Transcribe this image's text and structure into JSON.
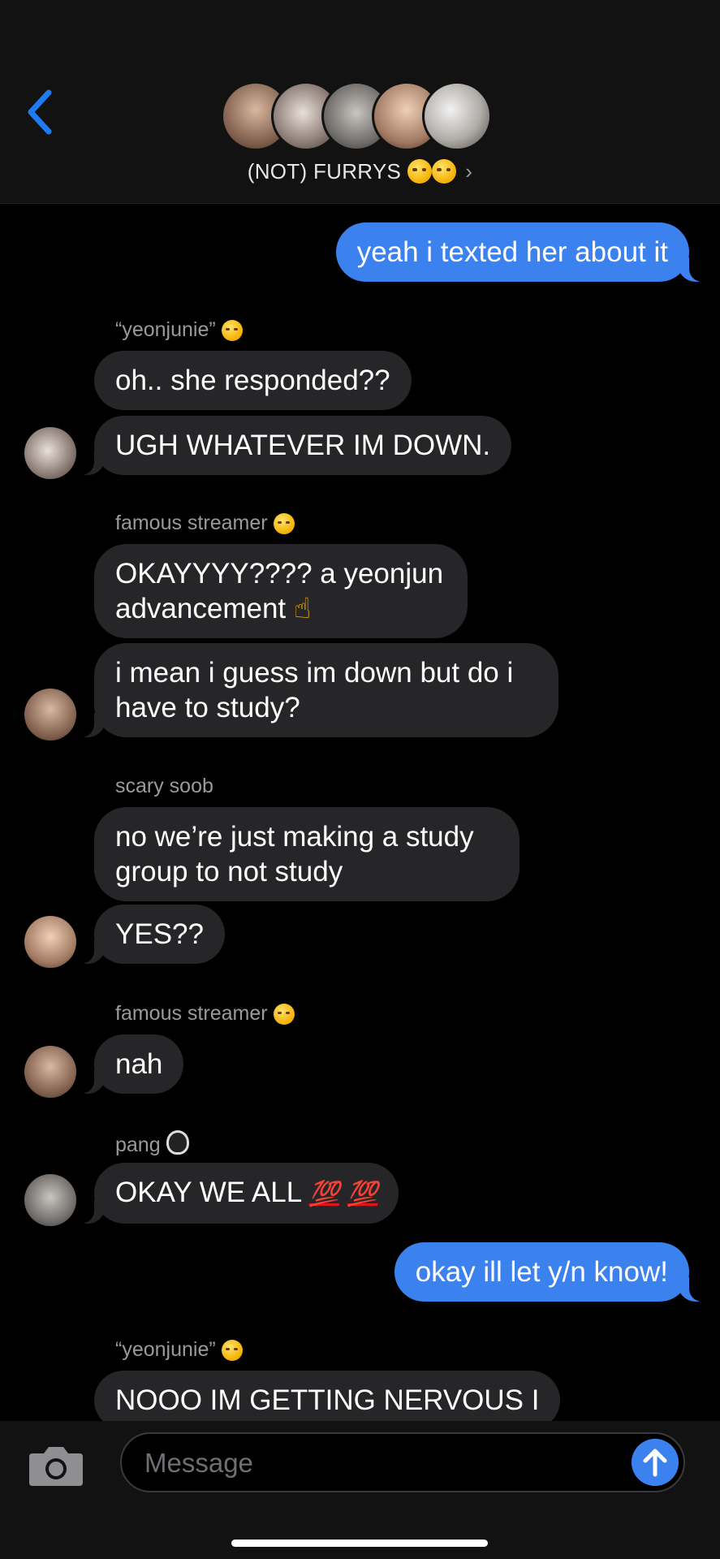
{
  "header": {
    "group_name": "(NOT) FURRYS",
    "back_icon": "chevron-left-icon",
    "title_emojis": [
      "confounded-face",
      "confounded-face"
    ],
    "avatar_count": 5
  },
  "messages": [
    {
      "type": "out",
      "text": "yeah i texted her about it"
    },
    {
      "type": "sender",
      "name": "“yeonjunie”",
      "emoji": "raised-eyebrow-face"
    },
    {
      "type": "in",
      "text": "oh.. she responded??"
    },
    {
      "type": "in",
      "text": "UGH WHATEVER IM DOWN."
    },
    {
      "type": "sender",
      "name": "famous streamer",
      "emoji": "raised-eyebrow-face"
    },
    {
      "type": "in",
      "line1": "OKAYYYY???? a yeonjun",
      "line2": "advancement",
      "emoji": "index-pointing-up"
    },
    {
      "type": "in",
      "line1": "i mean i guess im down but do i",
      "line2": "have to study?"
    },
    {
      "type": "sender",
      "name": "scary soob"
    },
    {
      "type": "in",
      "line1": "no we’re just making a study",
      "line2": "group to not study"
    },
    {
      "type": "in",
      "text": "YES??"
    },
    {
      "type": "sender",
      "name": "famous streamer",
      "emoji": "raised-eyebrow-face"
    },
    {
      "type": "in",
      "text": "nah"
    },
    {
      "type": "sender",
      "name": "pang",
      "emoji": "penguin"
    },
    {
      "type": "in",
      "text": "OKAY WE ALL",
      "emoji": "hundred-points",
      "emoji_text": "💯"
    },
    {
      "type": "out",
      "text": "okay ill let y/n know!"
    },
    {
      "type": "sender",
      "name": "“yeonjunie”",
      "emoji": "raised-eyebrow-face"
    },
    {
      "type": "in",
      "text": "NOOO IM GETTING NERVOUS I"
    }
  ],
  "composer": {
    "placeholder": "Message",
    "camera_icon": "camera-icon",
    "send_icon": "arrow-up-icon"
  },
  "colors": {
    "outgoing_bubble": "#3b82ef",
    "incoming_bubble": "#262628",
    "accent": "#1e7cf2"
  }
}
